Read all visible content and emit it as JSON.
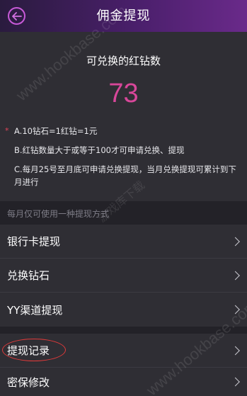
{
  "header": {
    "title": "佣金提现",
    "back_icon": "back-arrow-icon"
  },
  "info": {
    "title": "可兑换的红钻数",
    "count": "73",
    "count_color": "#d8479a",
    "rules": [
      "A.10钻石=1红钻=1元",
      "B.红钻数量大于或等于100才可申请兑换、提现",
      "C.每月25号至月底可申请兑换提现，当月兑换提现可累计到下月进行"
    ]
  },
  "section_hint": "每月仅可使用一种提现方式",
  "menu": {
    "items": [
      {
        "label": "银行卡提现"
      },
      {
        "label": "兑换钻石"
      },
      {
        "label": "YY渠道提现"
      },
      {
        "label": "提现记录"
      },
      {
        "label": "密保修改"
      }
    ]
  },
  "watermarks": [
    "www.hookbase.com",
    "www.hookbase.com",
    "游戏库下载"
  ]
}
